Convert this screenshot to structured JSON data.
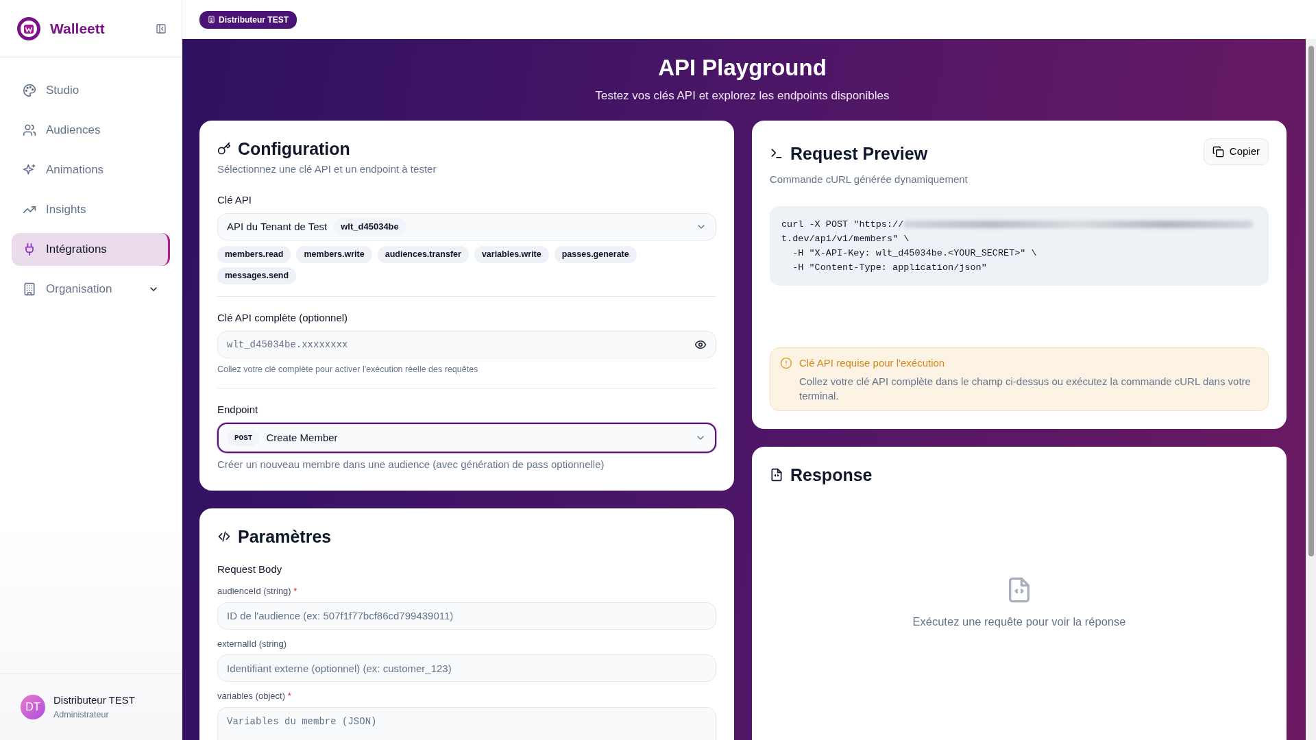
{
  "app": {
    "name": "Walleett"
  },
  "sidebar": {
    "items": [
      {
        "label": "Studio",
        "selected": false,
        "expandable": false
      },
      {
        "label": "Audiences",
        "selected": false,
        "expandable": false
      },
      {
        "label": "Animations",
        "selected": false,
        "expandable": false
      },
      {
        "label": "Insights",
        "selected": false,
        "expandable": false
      },
      {
        "label": "Intégrations",
        "selected": true,
        "expandable": false
      },
      {
        "label": "Organisation",
        "selected": false,
        "expandable": true
      }
    ]
  },
  "user": {
    "initials": "DT",
    "name": "Distributeur TEST",
    "role": "Administrateur"
  },
  "topbar": {
    "tenant_badge": "Distributeur TEST"
  },
  "header": {
    "title": "API Playground",
    "subtitle": "Testez vos clés API et explorez les endpoints disponibles"
  },
  "configuration": {
    "title": "Configuration",
    "subtitle": "Sélectionnez une clé API et un endpoint à tester",
    "api_key": {
      "label": "Clé API",
      "value": "API du Tenant de Test",
      "prefix": "wlt_d45034be",
      "scopes": [
        "members.read",
        "members.write",
        "audiences.transfer",
        "variables.write",
        "passes.generate",
        "messages.send"
      ]
    },
    "full_key": {
      "label": "Clé API complète (optionnel)",
      "placeholder": "wlt_d45034be.xxxxxxxx",
      "help": "Collez votre clé complète pour activer l'exécution réelle des requêtes"
    },
    "endpoint": {
      "label": "Endpoint",
      "method": "POST",
      "value": "Create Member",
      "focused": true,
      "help": "Créer un nouveau membre dans une audience (avec génération de pass optionnelle)"
    }
  },
  "parameters": {
    "title": "Paramètres",
    "section": "Request Body",
    "fields": [
      {
        "label": "audienceId (string)",
        "required_mark": "*",
        "kind": "input",
        "placeholder": "ID de l'audience (ex: 507f1f77bcf86cd799439011)"
      },
      {
        "label": "externalId (string)",
        "kind": "input",
        "placeholder": "Identifiant externe (optionnel) (ex: customer_123)"
      },
      {
        "label": "variables (object)",
        "required_mark": "*",
        "kind": "textarea",
        "placeholder": "Variables du membre (JSON)"
      }
    ]
  },
  "request_preview": {
    "title": "Request Preview",
    "subtitle": "Commande cURL générée dynamiquement",
    "copy_button": "Copier",
    "code_lines": [
      {
        "text": "curl -X POST \"https://",
        "redacted": true
      },
      {
        "text": "t.dev/api/v1/members\" \\",
        "redacted": false
      },
      {
        "text": "  -H \"X-API-Key: wlt_d45034be.<YOUR_SECRET>\" \\",
        "redacted": false
      },
      {
        "text": "  -H \"Content-Type: application/json\"",
        "redacted": false
      }
    ],
    "warning": {
      "title": "Clé API requise pour l'exécution",
      "text": "Collez votre clé API complète dans le champ ci-dessus ou exécutez la commande cURL dans votre terminal."
    }
  },
  "response": {
    "title": "Response",
    "empty_text": "Exécutez une requête pour voir la réponse"
  }
}
